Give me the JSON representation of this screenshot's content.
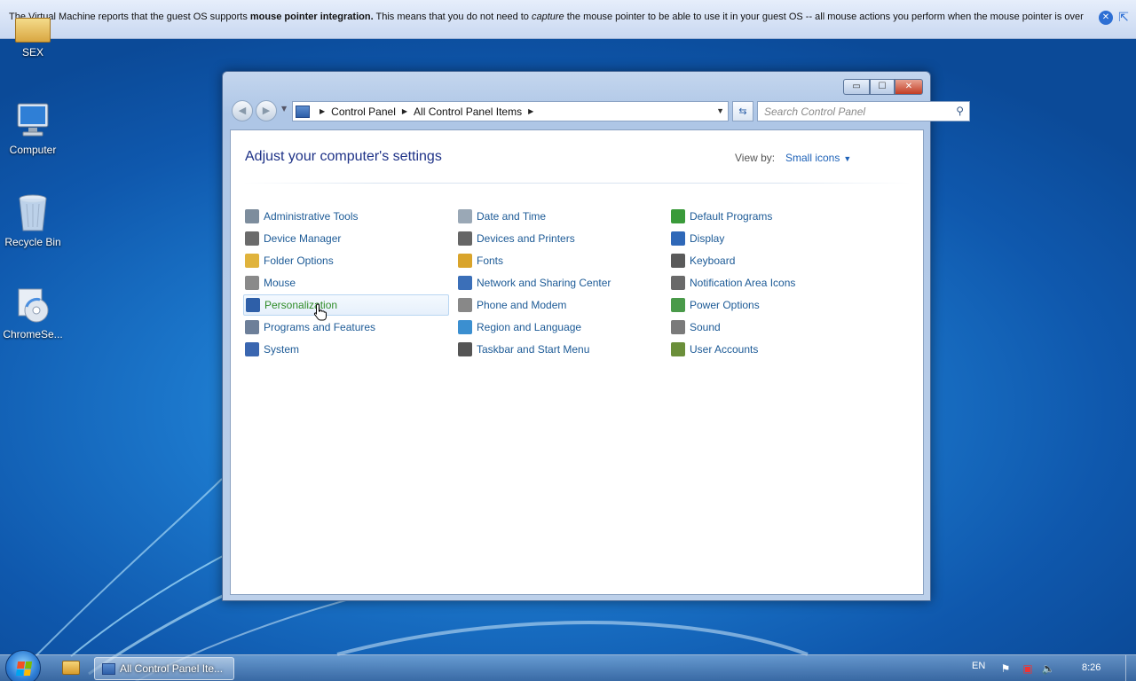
{
  "vm_notification": {
    "text_1": "The Virtual Machine reports that the guest OS supports ",
    "bold": "mouse pointer integration.",
    "text_2": " This means that you do not need to ",
    "italic": "capture",
    "text_3": " the mouse pointer to be able to use it in your guest OS -- all mouse actions you perform when the mouse pointer is over"
  },
  "desktop": {
    "icons": [
      {
        "label": "SEX",
        "icon": "folder-icon"
      },
      {
        "label": "Computer",
        "icon": "computer-icon"
      },
      {
        "label": "Recycle Bin",
        "icon": "recycle-bin-icon"
      },
      {
        "label": "ChromeSe...",
        "icon": "installer-icon"
      }
    ]
  },
  "window": {
    "caption_buttons": {
      "minimize": "▭",
      "maximize": "☐",
      "close": "✕"
    },
    "breadcrumb": [
      "Control Panel",
      "All Control Panel Items"
    ],
    "search_placeholder": "Search Control Panel",
    "heading": "Adjust your computer's settings",
    "view_by_label": "View by:",
    "view_by_value": "Small icons",
    "items": [
      {
        "label": "Administrative Tools",
        "icon": "admin-tools-icon",
        "color": "#7d8d9d"
      },
      {
        "label": "Device Manager",
        "icon": "device-manager-icon",
        "color": "#6b6b6b"
      },
      {
        "label": "Folder Options",
        "icon": "folder-options-icon",
        "color": "#e0b33c"
      },
      {
        "label": "Mouse",
        "icon": "mouse-icon",
        "color": "#8a8a8a"
      },
      {
        "label": "Personalization",
        "icon": "personalization-icon",
        "color": "#2e5fa8"
      },
      {
        "label": "Programs and Features",
        "icon": "programs-icon",
        "color": "#6d7f99"
      },
      {
        "label": "System",
        "icon": "system-icon",
        "color": "#3a66b0"
      },
      {
        "label": "Date and Time",
        "icon": "clock-icon",
        "color": "#9aa8b6"
      },
      {
        "label": "Devices and Printers",
        "icon": "printer-icon",
        "color": "#666666"
      },
      {
        "label": "Fonts",
        "icon": "fonts-icon",
        "color": "#d9a42b"
      },
      {
        "label": "Network and Sharing Center",
        "icon": "network-icon",
        "color": "#3b6fb8"
      },
      {
        "label": "Phone and Modem",
        "icon": "phone-icon",
        "color": "#888888"
      },
      {
        "label": "Region and Language",
        "icon": "globe-icon",
        "color": "#3b8fd0"
      },
      {
        "label": "Taskbar and Start Menu",
        "icon": "taskbar-icon",
        "color": "#555555"
      },
      {
        "label": "Default Programs",
        "icon": "default-programs-icon",
        "color": "#3a9a3a"
      },
      {
        "label": "Display",
        "icon": "display-icon",
        "color": "#2f68b8"
      },
      {
        "label": "Keyboard",
        "icon": "keyboard-icon",
        "color": "#5a5a5a"
      },
      {
        "label": "Notification Area Icons",
        "icon": "notification-icon",
        "color": "#6a6a6a"
      },
      {
        "label": "Power Options",
        "icon": "power-icon",
        "color": "#4a9a4a"
      },
      {
        "label": "Sound",
        "icon": "speaker-icon",
        "color": "#7a7a7a"
      },
      {
        "label": "User Accounts",
        "icon": "users-icon",
        "color": "#6b8f3a"
      }
    ]
  },
  "taskbar": {
    "task_label": "All Control Panel Ite...",
    "language": "EN",
    "clock": "8:26"
  }
}
